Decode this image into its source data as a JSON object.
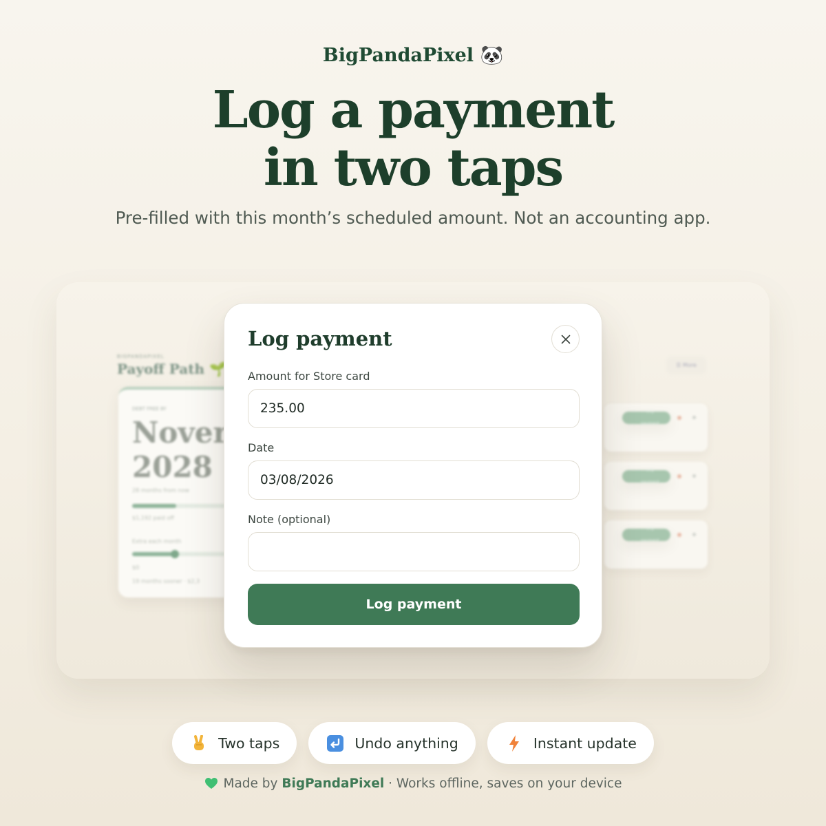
{
  "brand": {
    "name": "BigPandaPixel",
    "emoji": "🐼"
  },
  "headline": {
    "line1": "Log a payment",
    "line2": "in two taps"
  },
  "subhead": "Pre-filled with this month’s scheduled amount. Not an accounting app.",
  "background_app": {
    "title": "Payoff Path 🌱",
    "date_big_line1": "Nover",
    "date_big_line2": "2028"
  },
  "modal": {
    "title": "Log payment",
    "close_icon": "close-icon",
    "amount_label": "Amount for Store card",
    "amount_value": "235.00",
    "date_label": "Date",
    "date_value": "03/08/2026",
    "note_label": "Note (optional)",
    "note_value": "",
    "submit_label": "Log payment",
    "accent_color": "#3f7a56"
  },
  "features": [
    {
      "icon": "victory-hand-icon",
      "label": "Two taps"
    },
    {
      "icon": "undo-arrow-icon",
      "label": "Undo anything"
    },
    {
      "icon": "lightning-icon",
      "label": "Instant update"
    }
  ],
  "footer": {
    "prefix": "Made by",
    "brand": "BigPandaPixel",
    "suffix": "· Works offline, saves on your device",
    "icon": "green-heart-icon"
  }
}
